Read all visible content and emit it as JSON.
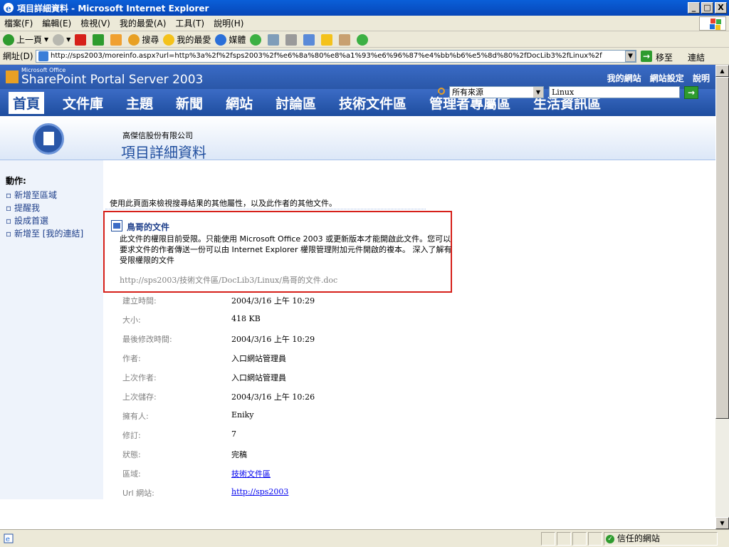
{
  "window": {
    "title": "項目詳細資料 - Microsoft Internet Explorer",
    "min": "_",
    "max": "□",
    "close": "X"
  },
  "menu": [
    "檔案(F)",
    "編輯(E)",
    "檢視(V)",
    "我的最愛(A)",
    "工具(T)",
    "說明(H)"
  ],
  "toolbar": {
    "back": "上一頁",
    "search": "搜尋",
    "favorites": "我的最愛",
    "media": "媒體"
  },
  "address": {
    "label": "網址(D)",
    "url": "http://sps2003/moreinfo.aspx?url=http%3a%2f%2fsps2003%2f%e6%8a%80%e8%a1%93%e6%96%87%e4%bb%b6%e5%8d%80%2fDocLib3%2fLinux%2f",
    "go": "移至",
    "links": "連結"
  },
  "sp": {
    "logo_small": "Microsoft Office",
    "logo": "SharePoint Portal Server 2003",
    "top_links": [
      "我的網站",
      "網站設定",
      "說明"
    ],
    "nav": [
      "首頁",
      "文件庫",
      "主題",
      "新聞",
      "網站",
      "討論區",
      "技術文件區",
      "管理者專屬區",
      "生活資訊區"
    ],
    "company": "高傑信股份有限公司",
    "page_title": "項目詳細資料",
    "search_scope": "所有來源",
    "search_query": "Linux"
  },
  "actions": {
    "heading": "動作:",
    "items": [
      "新增至區域",
      "提醒我",
      "設成首選",
      "新增至 [我的連結]"
    ]
  },
  "intro": "使用此頁面來檢視搜尋結果的其他屬性，以及此作者的其他文件。",
  "doc": {
    "title": "鳥哥的文件",
    "message": "此文件的權限目前受限。只能使用 Microsoft Office 2003 或更新版本才能開啟此文件。您可以要求文件的作者傳送一份可以由 Internet Explorer 權限管理附加元件開啟的複本。 深入了解有受限權限的文件",
    "url": "http://sps2003/技術文件區/DocLib3/Linux/鳥哥的文件.doc"
  },
  "props": [
    {
      "label": "建立時間:",
      "value": "2004/3/16 上午 10:29"
    },
    {
      "label": "大小:",
      "value": "418 KB"
    },
    {
      "label": "最後修改時間:",
      "value": "2004/3/16 上午 10:29"
    },
    {
      "label": "作者:",
      "value": "入口網站管理員"
    },
    {
      "label": "上次作者:",
      "value": "入口網站管理員"
    },
    {
      "label": "上次儲存:",
      "value": "2004/3/16 上午 10:26"
    },
    {
      "label": "擁有人:",
      "value": "Eniky"
    },
    {
      "label": "修訂:",
      "value": "7"
    },
    {
      "label": "狀態:",
      "value": "完稿"
    },
    {
      "label": "區域:",
      "value": "技術文件區"
    },
    {
      "label": "Url 網站:",
      "value": "http://sps2003"
    }
  ],
  "status": {
    "zone": "信任的網站"
  }
}
